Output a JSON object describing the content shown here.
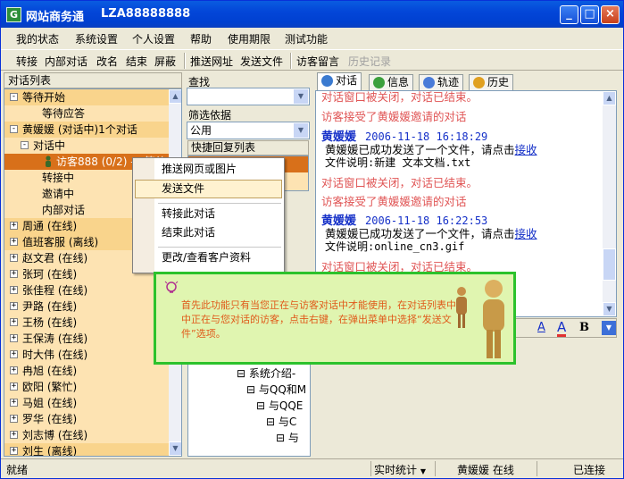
{
  "window": {
    "app_logo": "G",
    "title": "网站商务通",
    "account_id": "LZA88888888",
    "minimize_glyph": "_",
    "maximize_glyph": "□",
    "close_glyph": "×"
  },
  "menubar": [
    "我的状态",
    "系统设置",
    "个人设置",
    "帮助",
    "使用期限",
    "测试功能"
  ],
  "toolbar": {
    "group1": [
      "转接",
      "内部对话",
      "改名",
      "结束",
      "屏蔽"
    ],
    "group2": [
      "推送网址",
      "发送文件"
    ],
    "group3": [
      "访客留言"
    ],
    "disabled": "历史记录"
  },
  "left_panel": {
    "header": "对话列表",
    "rows": [
      {
        "exp": "-",
        "label": "等待开始",
        "indent": 0,
        "band": true
      },
      {
        "exp": "",
        "label": "等待应答",
        "indent": 2,
        "band": false
      },
      {
        "exp": "-",
        "label": "黄媛媛 (对话中)1个对话",
        "indent": 0,
        "band": true
      },
      {
        "exp": "-",
        "label": "对话中",
        "indent": 1,
        "band": false
      },
      {
        "exp": "",
        "label": "访客888 (0/2) — 等待",
        "indent": 3,
        "band": false,
        "selected": true
      },
      {
        "exp": "",
        "label": "转接中",
        "indent": 2,
        "band": false
      },
      {
        "exp": "",
        "label": "邀请中",
        "indent": 2,
        "band": false
      },
      {
        "exp": "",
        "label": "内部对话",
        "indent": 2,
        "band": false
      },
      {
        "exp": "+",
        "label": "周通 (在线)",
        "indent": 0,
        "band": true
      },
      {
        "exp": "+",
        "label": "值班客服 (离线)",
        "indent": 0,
        "band": true
      },
      {
        "exp": "+",
        "label": "赵文君 (在线)",
        "indent": 0,
        "band": false
      },
      {
        "exp": "+",
        "label": "张珂 (在线)",
        "indent": 0,
        "band": false
      },
      {
        "exp": "+",
        "label": "张佳程 (在线)",
        "indent": 0,
        "band": false
      },
      {
        "exp": "+",
        "label": "尹路 (在线)",
        "indent": 0,
        "band": false
      },
      {
        "exp": "+",
        "label": "王杨 (在线)",
        "indent": 0,
        "band": false
      },
      {
        "exp": "+",
        "label": "王保涛 (在线)",
        "indent": 0,
        "band": false
      },
      {
        "exp": "+",
        "label": "时大伟 (在线)",
        "indent": 0,
        "band": false
      },
      {
        "exp": "+",
        "label": "冉旭 (在线)",
        "indent": 0,
        "band": false
      },
      {
        "exp": "+",
        "label": "欧阳 (繁忙)",
        "indent": 0,
        "band": false
      },
      {
        "exp": "+",
        "label": "马姐 (在线)",
        "indent": 0,
        "band": false
      },
      {
        "exp": "+",
        "label": "罗华 (在线)",
        "indent": 0,
        "band": false
      },
      {
        "exp": "+",
        "label": "刘志博 (在线)",
        "indent": 0,
        "band": false
      },
      {
        "exp": "+",
        "label": "刘生 (离线)",
        "indent": 0,
        "band": true
      }
    ]
  },
  "middle_panel": {
    "search_label": "查找",
    "search_value": "",
    "filter_label": "筛选依据",
    "filter_value": "公用",
    "quick_reply_tab": "快捷回复列表",
    "tree": [
      {
        "label": "⊟ 系统介绍-",
        "indent": 1
      },
      {
        "label": "⊟ 与QQ和M",
        "indent": 2
      },
      {
        "label": "⊟ 与QQE",
        "indent": 3
      },
      {
        "label": "⊟ 与C",
        "indent": 4
      },
      {
        "label": "⊟ 与",
        "indent": 5
      }
    ]
  },
  "right_panel": {
    "tabs": [
      "对话",
      "信息",
      "轨迹",
      "历史"
    ],
    "messages": [
      {
        "kind": "sys",
        "text": "对话窗口被关闭，对话已结束。"
      },
      {
        "kind": "sys",
        "text": "访客接受了黄媛媛邀请的对话"
      },
      {
        "kind": "head",
        "sender": "黄媛媛",
        "time": "2006-11-18 16:18:29"
      },
      {
        "kind": "body",
        "text": "黄媛媛已成功发送了一个文件，请点击",
        "link": "接收"
      },
      {
        "kind": "body2",
        "text": "文件说明:新建 文本文档.txt"
      },
      {
        "kind": "sys",
        "text": "对话窗口被关闭，对话已结束。"
      },
      {
        "kind": "sys",
        "text": "访客接受了黄媛媛邀请的对话"
      },
      {
        "kind": "head",
        "sender": "黄媛媛",
        "time": "2006-11-18 16:22:53"
      },
      {
        "kind": "body",
        "text": "黄媛媛已成功发送了一个文件，请点击",
        "link": "接收"
      },
      {
        "kind": "body2",
        "text": "文件说明:online_cn3.gif"
      },
      {
        "kind": "sys",
        "text": "对话窗口被关闭，对话已结束。"
      }
    ],
    "format_bar": {
      "font_glyph": "A",
      "color_glyph": "A",
      "bold_glyph": "B"
    }
  },
  "context_menu": {
    "items": [
      "推送网页或图片",
      "发送文件",
      "转接此对话",
      "结束此对话",
      "更改/查看客户资料"
    ],
    "hover_index": 1
  },
  "tip": {
    "text": "首先此功能只有当您正在与访客对话中才能使用，在对话列表中选 中正在与您对话的访客，点击右键，在弹出菜单中选择“发送文件”选项。"
  },
  "statusbar": {
    "ready": "就绪",
    "stats": "实时统计",
    "user_status": "黄媛媛 在线",
    "connection": "已连接"
  },
  "colors": {
    "left_bg": "#fde3b2",
    "band": "#f9d48c",
    "selected": "#d8701a",
    "sys_text": "#e05555",
    "sender": "#1530c8",
    "tip_border": "#2cc22c",
    "tip_bg": "#e0f5b0"
  }
}
